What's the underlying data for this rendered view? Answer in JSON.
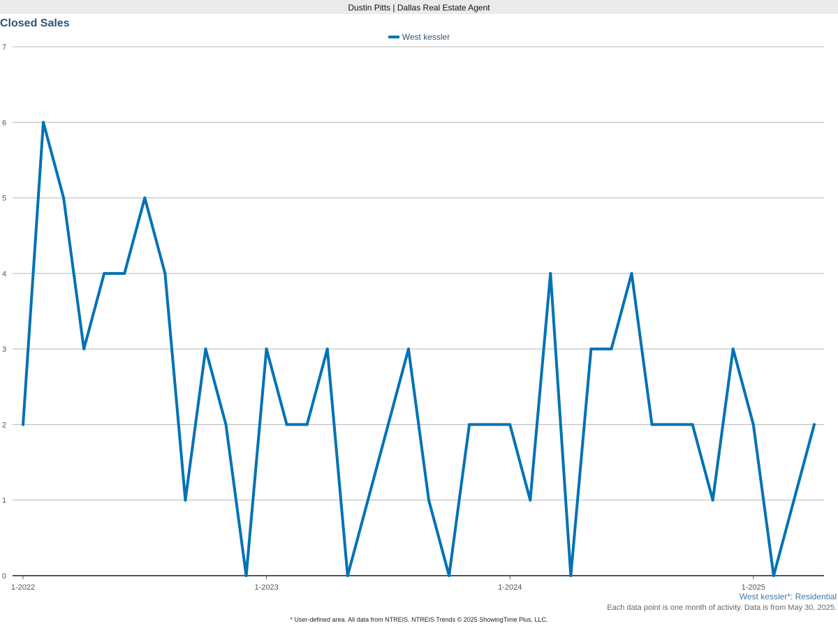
{
  "header": {
    "title": "Dustin Pitts | Dallas Real Estate Agent"
  },
  "chart_data": {
    "type": "line",
    "title": "Closed Sales",
    "xlabel": "",
    "ylabel": "",
    "ylim": [
      0,
      7
    ],
    "yticks": [
      0,
      1,
      2,
      3,
      4,
      5,
      6,
      7
    ],
    "x_tick_labels": [
      "1-2022",
      "1-2023",
      "1-2024",
      "1-2025"
    ],
    "x": [
      "1-2022",
      "2-2022",
      "3-2022",
      "4-2022",
      "5-2022",
      "6-2022",
      "7-2022",
      "8-2022",
      "9-2022",
      "10-2022",
      "11-2022",
      "12-2022",
      "1-2023",
      "2-2023",
      "3-2023",
      "4-2023",
      "5-2023",
      "6-2023",
      "7-2023",
      "8-2023",
      "9-2023",
      "10-2023",
      "11-2023",
      "12-2023",
      "1-2024",
      "2-2024",
      "3-2024",
      "4-2024",
      "5-2024",
      "6-2024",
      "7-2024",
      "8-2024",
      "9-2024",
      "10-2024",
      "11-2024",
      "12-2024",
      "1-2025",
      "2-2025",
      "3-2025",
      "4-2025",
      "5-2025"
    ],
    "series": [
      {
        "name": "West kessler",
        "color": "#0072b5",
        "values": [
          2,
          6,
          5,
          3,
          4,
          4,
          5,
          4,
          1,
          3,
          2,
          0,
          3,
          2,
          2,
          3,
          0,
          1,
          2,
          3,
          1,
          0,
          2,
          2,
          2,
          1,
          4,
          0,
          3,
          3,
          4,
          2,
          2,
          2,
          1,
          3,
          2,
          0,
          1,
          2
        ]
      }
    ],
    "legend_position": "top-center",
    "grid": true
  },
  "annotations": {
    "area_label": "West kessler*: Residential",
    "note": "Each data point is one month of activity. Data is from May 30, 2025.",
    "footer": "* User-defined area. All data from NTREIS. NTREIS Trends © 2025 ShowingTime Plus, LLC."
  }
}
